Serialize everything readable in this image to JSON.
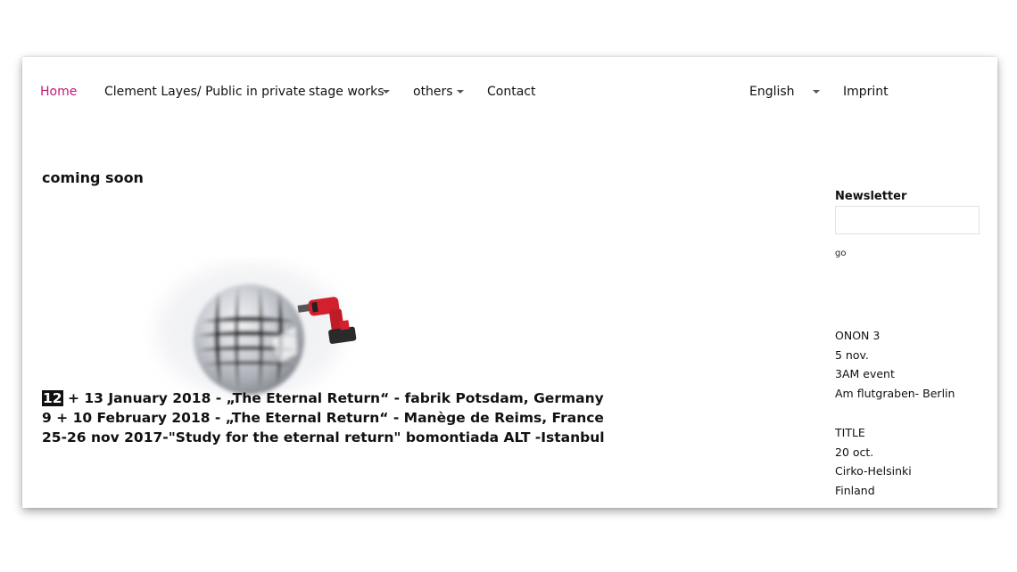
{
  "nav": {
    "home": "Home",
    "public_in_private": "Clement Layes/ Public in private",
    "stage_works": "stage works",
    "others": "others",
    "contact": "Contact",
    "language": "English",
    "imprint": "Imprint"
  },
  "main": {
    "heading": "coming soon",
    "events": [
      {
        "date_highlight": "12",
        "rest": " + 13 January 2018 - „The Eternal Return“ - fabrik Potsdam, Germany"
      },
      {
        "text": "9 + 10 February 2018 - „The Eternal Return“ - Manège de Reims, France"
      },
      {
        "text": "25-26 nov 2017-\"Study for the eternal return\" bomontiada ALT -Istanbul"
      }
    ]
  },
  "sidebar": {
    "newsletter_label": "Newsletter",
    "go_label": "go",
    "entries": [
      {
        "lines": [
          "ONON 3",
          "5 nov.",
          "3AM event",
          "Am flutgraben- Berlin"
        ]
      },
      {
        "lines": [
          "TITLE",
          "20 oct.",
          "Cirko-Helsinki",
          "Finland"
        ]
      }
    ]
  },
  "colors": {
    "accent": "#c2187a",
    "text": "#111111",
    "drill_red": "#d3202e"
  },
  "icons": {
    "dropdown": "chevron-down-icon"
  }
}
